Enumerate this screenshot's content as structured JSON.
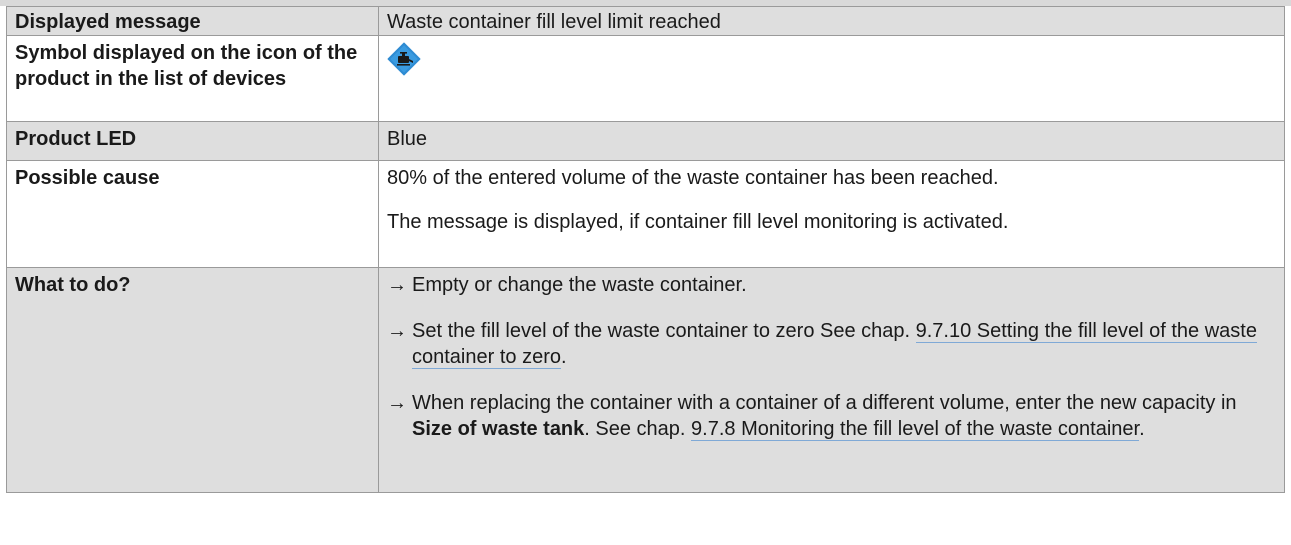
{
  "rows": [
    {
      "label": "Displayed message",
      "value": "Waste container fill level limit reached"
    },
    {
      "label": "Symbol displayed on the icon of the product in the list of devices",
      "icon": "waste-container-warning-icon",
      "icon_color": "#2e8bd2"
    },
    {
      "label": "Product LED",
      "value": "Blue"
    },
    {
      "label": "Possible cause",
      "paragraphs": [
        "80% of the entered volume of the waste container has been reached.",
        "The message is displayed, if container fill level monitoring is activated."
      ]
    },
    {
      "label": "What to do?"
    }
  ],
  "todo": {
    "arrow": "→",
    "step1": "Empty or change the waste container.",
    "step2_text": "Set the fill level of the waste container to zero See chap. ",
    "step2_link": "9.7.10 Setting the fill level of the waste container to zero",
    "step2_end": ".",
    "step3_text": "When replacing the container with a container of a different volume, enter the new capacity in ",
    "step3_bold": "Size of waste tank",
    "step3_mid": ". See chap. ",
    "step3_link": "9.7.8 Monitoring the fill level of the waste container",
    "step3_end": "."
  }
}
